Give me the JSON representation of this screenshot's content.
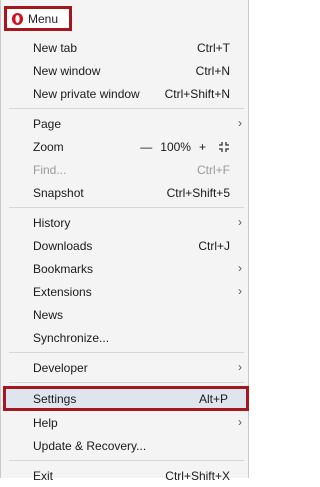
{
  "menu_button": {
    "label": "Menu",
    "icon": "opera-logo-icon",
    "accent": "#a4171f"
  },
  "items": {
    "new_tab": {
      "label": "New tab",
      "shortcut": "Ctrl+T"
    },
    "new_window": {
      "label": "New window",
      "shortcut": "Ctrl+N"
    },
    "new_private": {
      "label": "New private window",
      "shortcut": "Ctrl+Shift+N"
    },
    "page": {
      "label": "Page"
    },
    "zoom": {
      "label": "Zoom",
      "minus": "—",
      "value": "100%",
      "plus": "+"
    },
    "find": {
      "label": "Find...",
      "shortcut": "Ctrl+F"
    },
    "snapshot": {
      "label": "Snapshot",
      "shortcut": "Ctrl+Shift+5"
    },
    "history": {
      "label": "History"
    },
    "downloads": {
      "label": "Downloads",
      "shortcut": "Ctrl+J"
    },
    "bookmarks": {
      "label": "Bookmarks"
    },
    "extensions": {
      "label": "Extensions"
    },
    "news": {
      "label": "News"
    },
    "synchronize": {
      "label": "Synchronize..."
    },
    "developer": {
      "label": "Developer"
    },
    "settings": {
      "label": "Settings",
      "shortcut": "Alt+P"
    },
    "help": {
      "label": "Help"
    },
    "update": {
      "label": "Update & Recovery..."
    },
    "exit": {
      "label": "Exit",
      "shortcut": "Ctrl+Shift+X"
    }
  },
  "arrow_glyph": "›"
}
